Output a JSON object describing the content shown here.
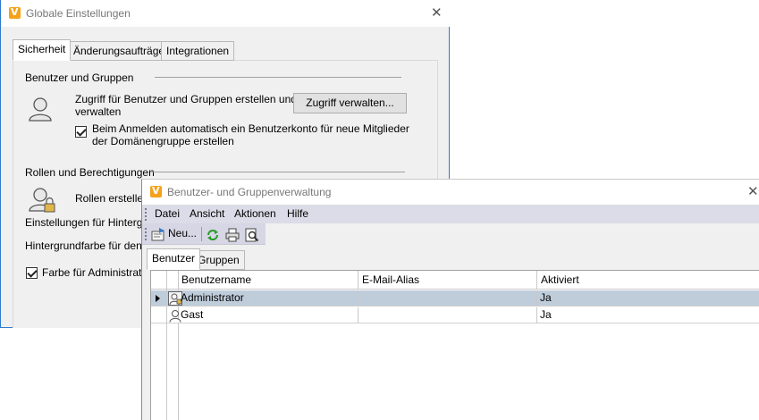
{
  "global_settings": {
    "title": "Globale Einstellungen",
    "tabs": [
      {
        "label": "Sicherheit",
        "active": true
      },
      {
        "label": "Änderungsaufträge",
        "active": false
      },
      {
        "label": "Integrationen",
        "active": false
      }
    ],
    "users_groups": {
      "heading": "Benutzer und Gruppen",
      "description_line1": "Zugriff für Benutzer und Gruppen erstellen und",
      "description_line2": "verwalten",
      "manage_button": "Zugriff verwalten...",
      "auto_account_line1": "Beim Anmelden automatisch ein Benutzerkonto für neue Mitglieder",
      "auto_account_line2": "der Domänengruppe erstellen",
      "auto_account_checked": true
    },
    "roles": {
      "heading": "Rollen und Berechtigungen",
      "description": "Rollen erstellen"
    },
    "background_settings": "Einstellungen für Hintergru",
    "background_color_label": "Hintergrundfarbe für den A",
    "admin_color_label": "Farbe für Administrato",
    "admin_color_checked": true
  },
  "user_management": {
    "title": "Benutzer- und Gruppenverwaltung",
    "menu": [
      "Datei",
      "Ansicht",
      "Aktionen",
      "Hilfe"
    ],
    "toolbar": {
      "new_label": "Neu...",
      "icons": [
        "new-user-icon",
        "refresh-icon",
        "print-icon",
        "print-preview-icon"
      ]
    },
    "tabs": [
      {
        "label": "Benutzer",
        "active": true
      },
      {
        "label": "Gruppen",
        "active": false
      }
    ],
    "columns": [
      "Benutzername",
      "E-Mail-Alias",
      "Aktiviert"
    ],
    "rows": [
      {
        "username": "Administrator",
        "email": "",
        "active": "Ja",
        "selected": true,
        "icon": "admin-user-icon"
      },
      {
        "username": "Gast",
        "email": "",
        "active": "Ja",
        "selected": false,
        "icon": "user-icon"
      }
    ]
  },
  "colors": {
    "window_border": "#2e7bcf",
    "menubar": "#dcdce8",
    "selected_row": "#bfcddb",
    "app_icon": "#f5a21b"
  }
}
